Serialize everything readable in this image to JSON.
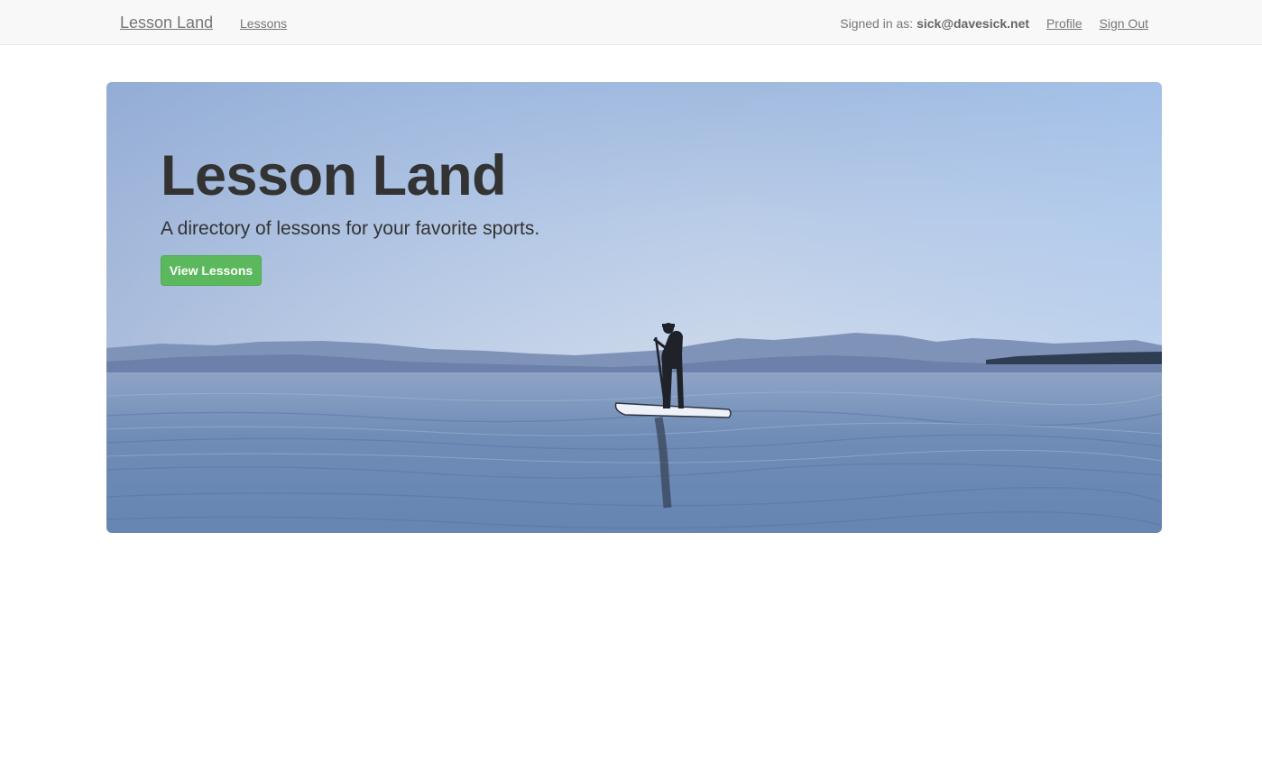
{
  "navbar": {
    "brand": "Lesson Land",
    "lessons_link": "Lessons",
    "signed_in_label": "Signed in as:",
    "signed_in_email": "sick@davesick.net",
    "profile_link": "Profile",
    "sign_out_link": "Sign Out"
  },
  "hero": {
    "title": "Lesson Land",
    "subtitle": "A directory of lessons for your favorite sports.",
    "button_label": "View Lessons"
  },
  "colors": {
    "navbar_bg": "#f8f8f8",
    "primary_button": "#5cb85c",
    "text_dark": "#333333",
    "nav_text": "#777777"
  }
}
